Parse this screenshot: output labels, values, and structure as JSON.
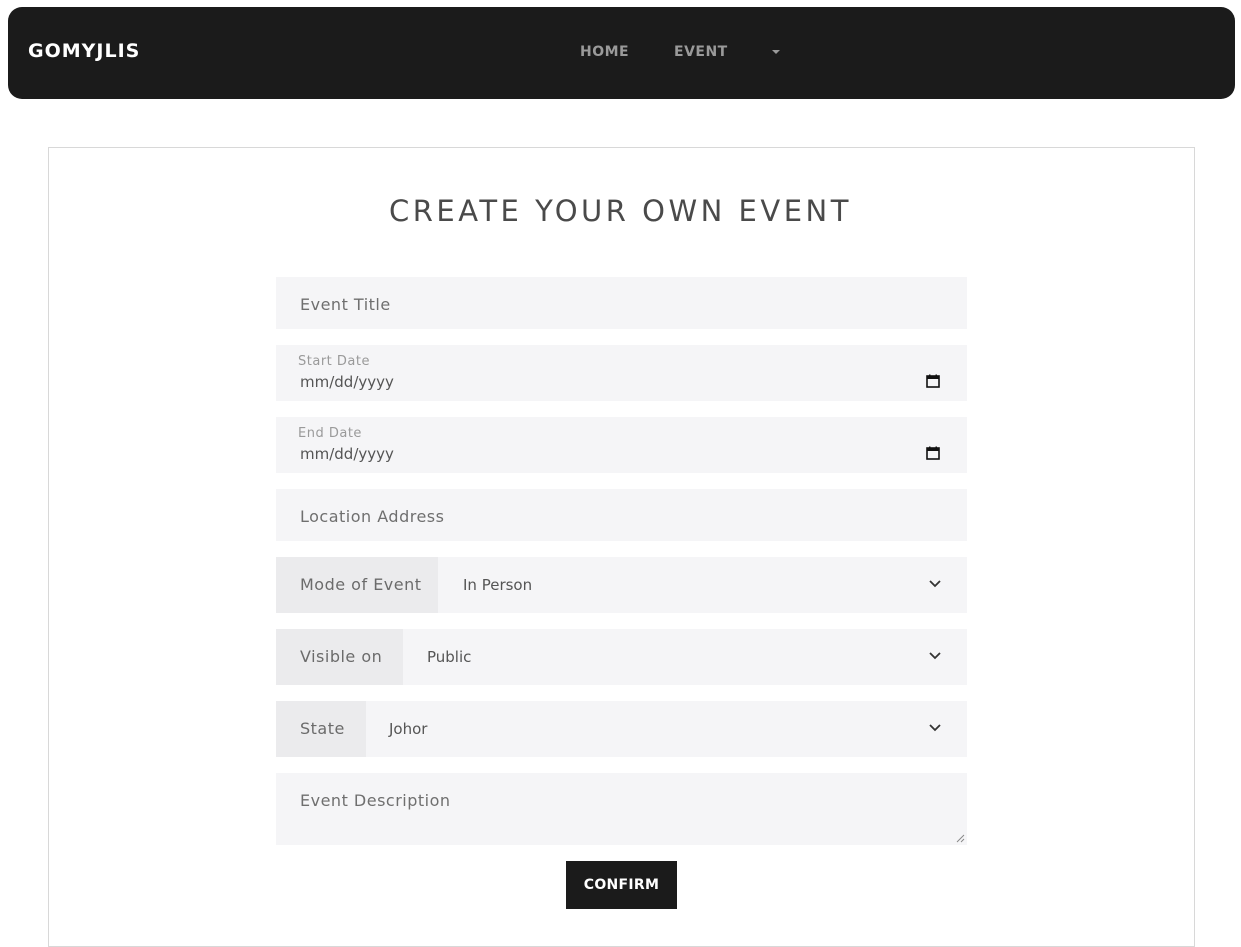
{
  "navbar": {
    "brand": "GOMYJLIS",
    "links": [
      "HOME",
      "EVENT"
    ],
    "dropdown_icon": "caret-down-icon"
  },
  "form": {
    "title": "CREATE YOUR OWN EVENT",
    "event_title_placeholder": "Event Title",
    "start_date": {
      "label": "Start Date",
      "value": "mm/dd/yyyy",
      "icon": "calendar-icon"
    },
    "end_date": {
      "label": "End Date",
      "value": "mm/dd/yyyy",
      "icon": "calendar-icon"
    },
    "location_placeholder": "Location Address",
    "mode": {
      "label": "Mode of Event",
      "value": "In Person",
      "icon": "chevron-down-icon"
    },
    "visibility": {
      "label": "Visible on",
      "value": "Public",
      "icon": "chevron-down-icon"
    },
    "state": {
      "label": "State",
      "value": "Johor",
      "icon": "chevron-down-icon"
    },
    "description_placeholder": "Event Description",
    "confirm_label": "CONFIRM"
  },
  "colors": {
    "navbar_bg": "#1b1b1b",
    "field_bg": "#f5f5f7",
    "label_bg": "#ebebed",
    "button_bg": "#1b1b1b"
  }
}
